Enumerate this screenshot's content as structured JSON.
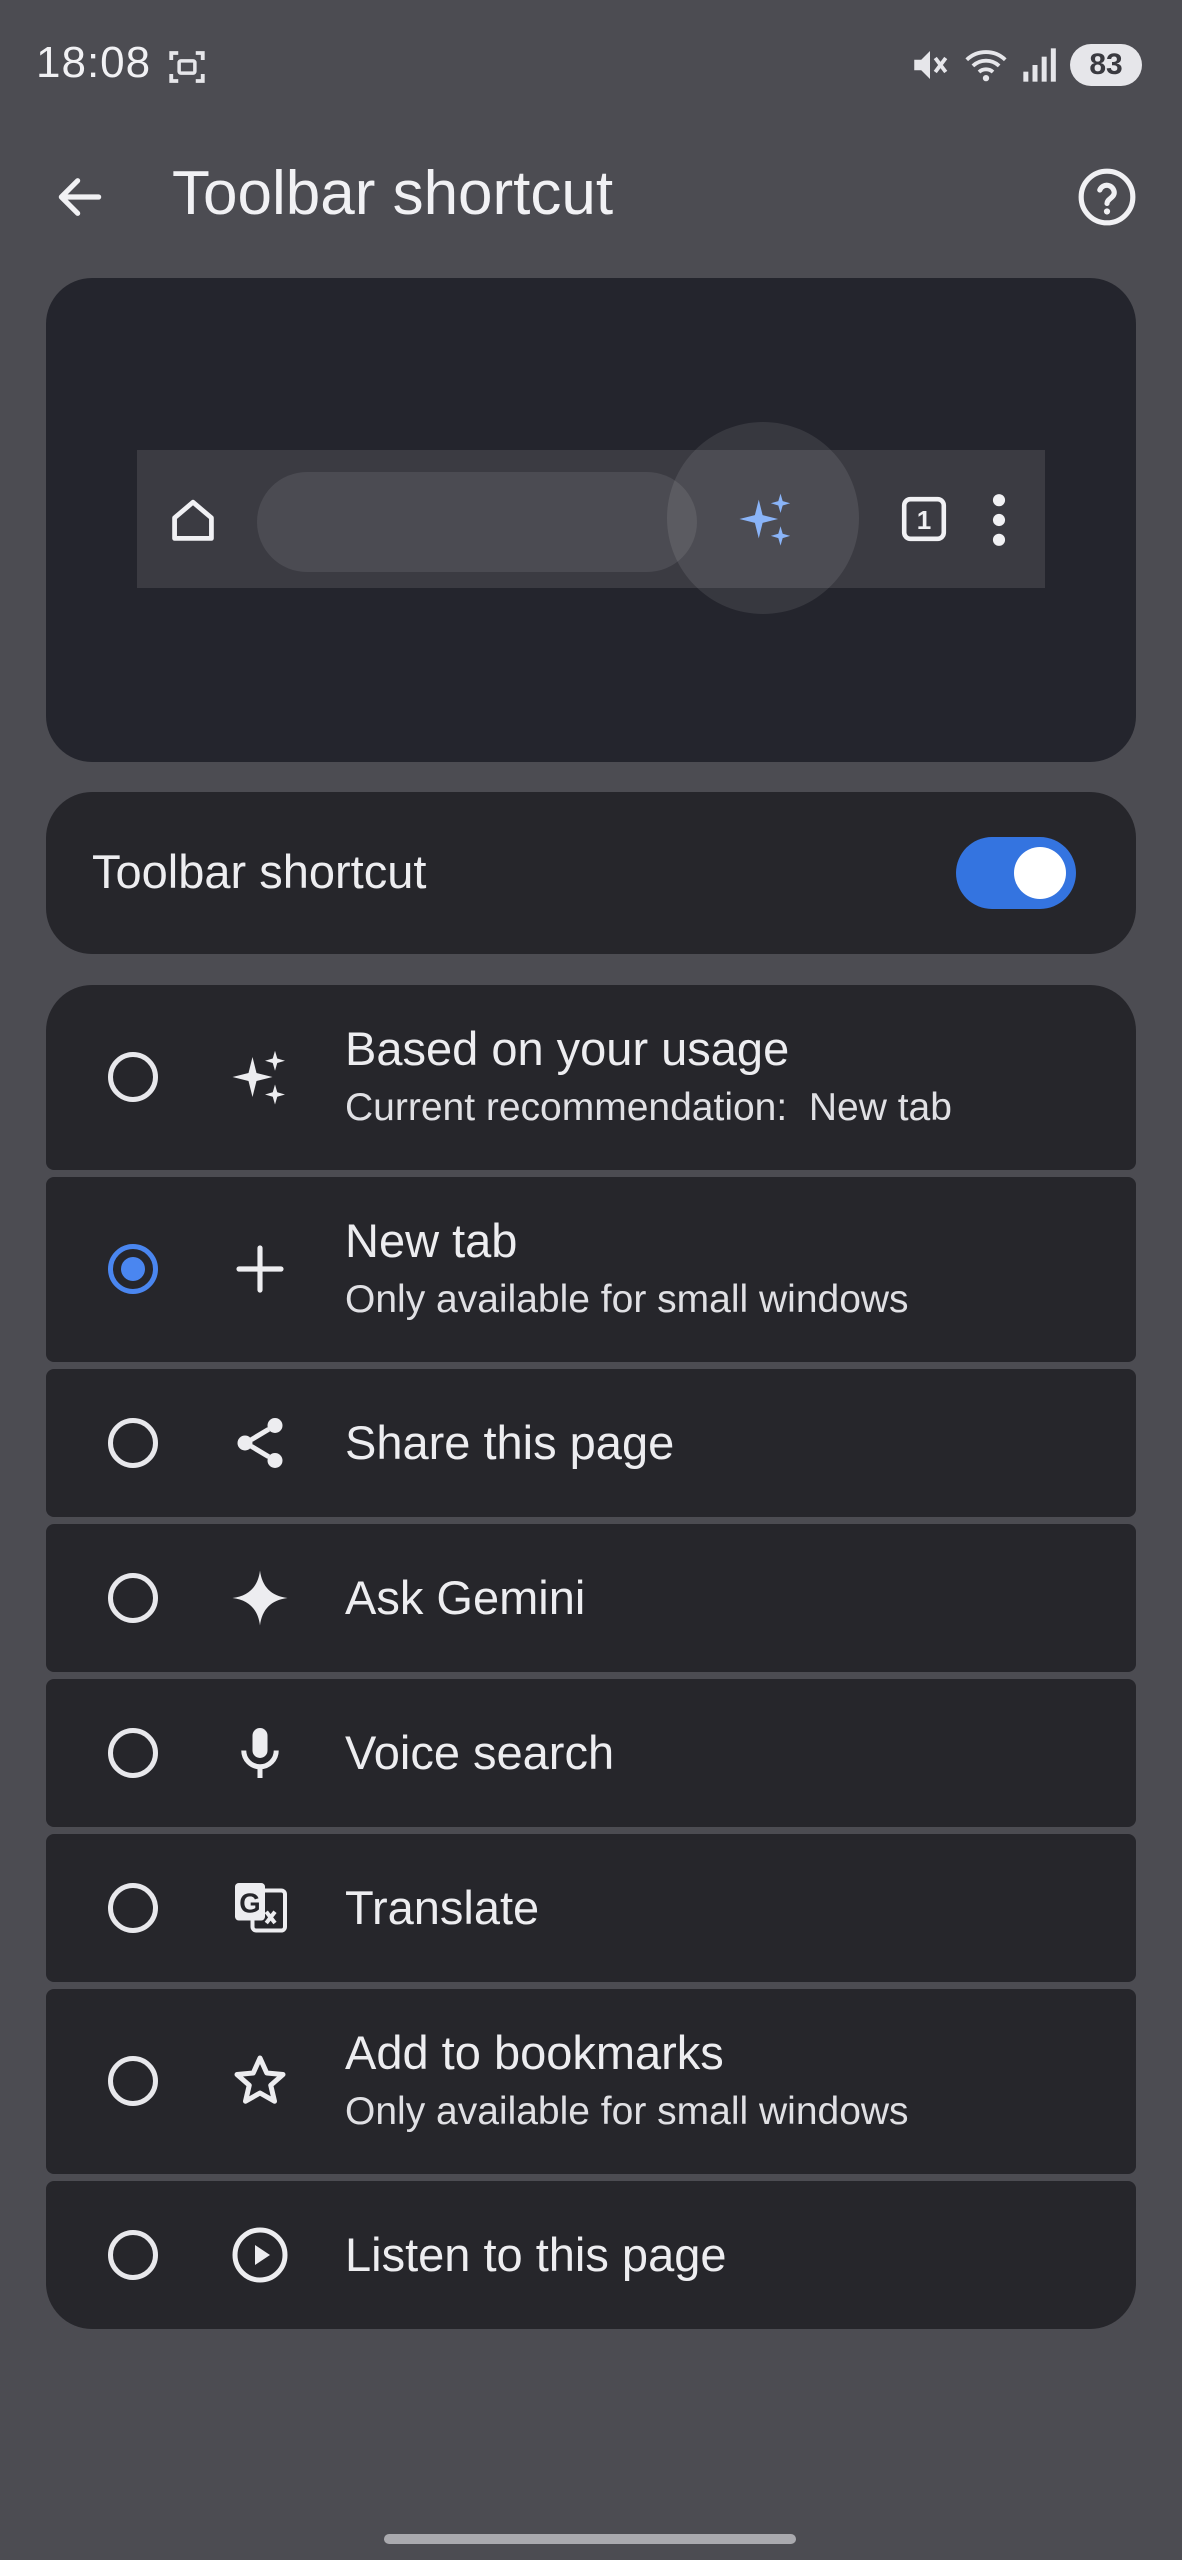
{
  "status_bar": {
    "time": "18:08",
    "battery": "83",
    "icons": [
      "screenshot-icon",
      "mute-icon",
      "wifi-icon",
      "signal-icon",
      "battery-icon"
    ]
  },
  "app_bar": {
    "title": "Toolbar shortcut",
    "icons": [
      "back-arrow-icon",
      "help-icon"
    ]
  },
  "preview": {
    "tab_count": "1",
    "icons": [
      "home-icon",
      "sparkle-icon",
      "tab-switcher-icon",
      "more-vert-icon"
    ],
    "highlight_color": "#8ab4f8"
  },
  "toggle": {
    "label": "Toolbar shortcut",
    "enabled": true,
    "accent": "#3474e0"
  },
  "options": [
    {
      "title": "Based on your usage",
      "subtitle": "Current recommendation:  New tab",
      "icon": "sparkle-icon",
      "selected": false
    },
    {
      "title": "New tab",
      "subtitle": "Only available for small windows",
      "icon": "plus-icon",
      "selected": true
    },
    {
      "title": "Share this page",
      "subtitle": "",
      "icon": "share-icon",
      "selected": false
    },
    {
      "title": "Ask Gemini",
      "subtitle": "",
      "icon": "gemini-icon",
      "selected": false
    },
    {
      "title": "Voice search",
      "subtitle": "",
      "icon": "mic-icon",
      "selected": false
    },
    {
      "title": "Translate",
      "subtitle": "",
      "icon": "translate-icon",
      "selected": false
    },
    {
      "title": "Add to bookmarks",
      "subtitle": "Only available for small windows",
      "icon": "star-icon",
      "selected": false
    },
    {
      "title": "Listen to this page",
      "subtitle": "",
      "icon": "play-circle-icon",
      "selected": false
    }
  ]
}
